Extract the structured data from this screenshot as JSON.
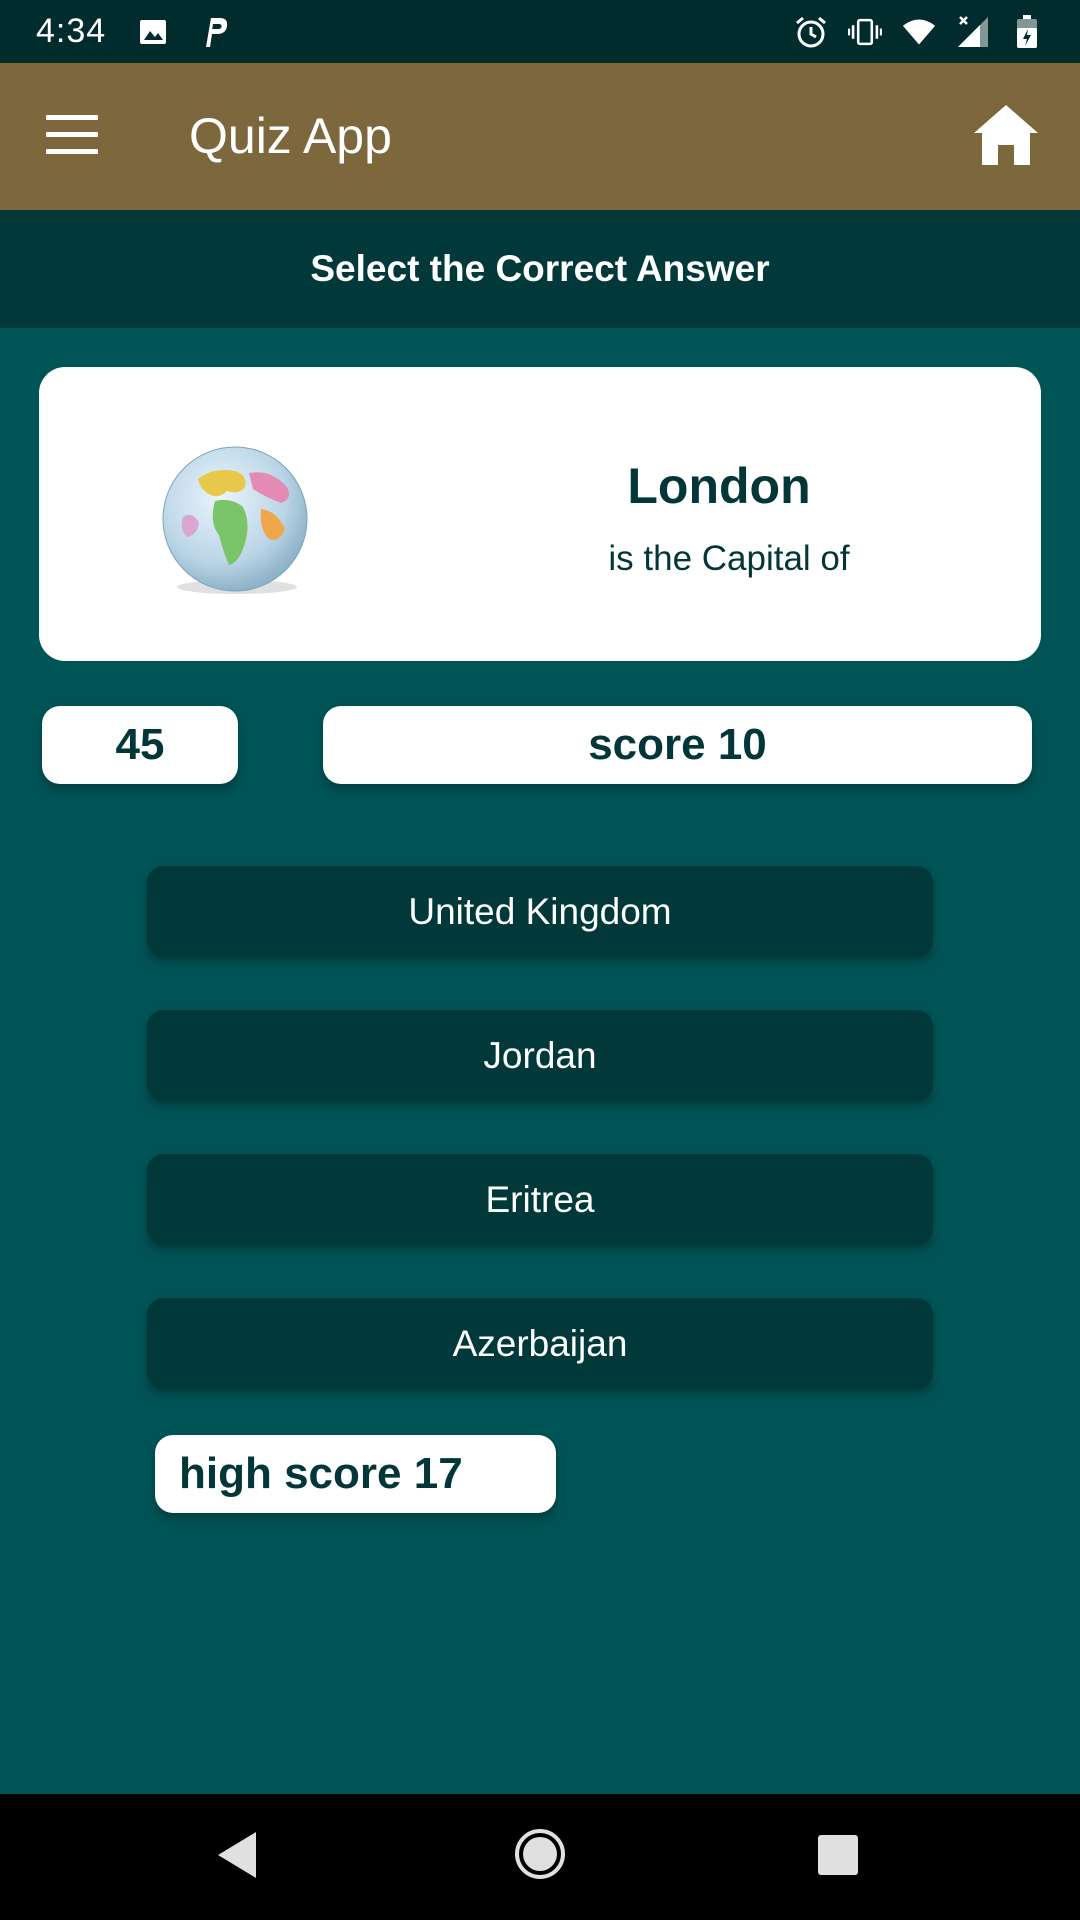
{
  "status_bar": {
    "time": "4:34",
    "icons": [
      "image-icon",
      "parking-icon",
      "alarm-icon",
      "vibrate-icon",
      "wifi-icon",
      "signal-icon",
      "battery-icon"
    ]
  },
  "app_bar": {
    "title": "Quiz App",
    "color": "#7d673c"
  },
  "subheader": {
    "text": "Select the Correct Answer"
  },
  "question": {
    "word": "London",
    "prompt": "is the Capital of"
  },
  "timer": {
    "value": "45"
  },
  "score": {
    "label": "score 10"
  },
  "answers": [
    {
      "label": "United Kingdom"
    },
    {
      "label": "Jordan"
    },
    {
      "label": "Eritrea"
    },
    {
      "label": "Azerbaijan"
    }
  ],
  "high_score": {
    "label": "high score 17"
  },
  "colors": {
    "background": "#015456",
    "dark_teal": "#01393a",
    "text_dark": "#023638"
  }
}
